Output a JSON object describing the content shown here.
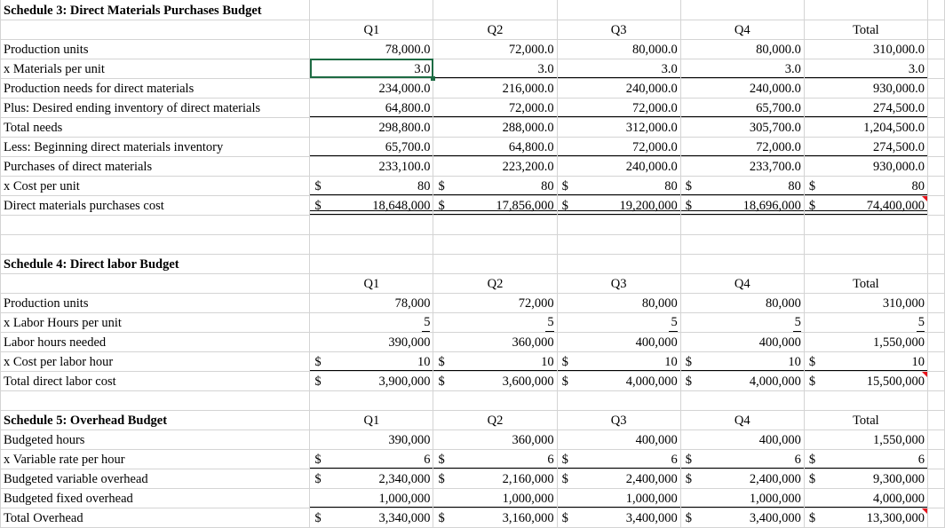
{
  "sheet": {
    "columns": [
      "",
      "Q1",
      "Q2",
      "Q3",
      "Q4",
      "Total"
    ],
    "selected_cell_value": "3.0",
    "selection_color": "#1d6b43",
    "comment_flag_color": "#e8121a",
    "gridline_color": "#d4d4d4"
  },
  "schedule3": {
    "title": "Schedule 3:  Direct Materials Purchases Budget",
    "headers": {
      "q1": "Q1",
      "q2": "Q2",
      "q3": "Q3",
      "q4": "Q4",
      "total": "Total"
    },
    "rows": [
      {
        "label": "Production units",
        "q1": "78,000.0",
        "q2": "72,000.0",
        "q3": "80,000.0",
        "q4": "80,000.0",
        "total": "310,000.0"
      },
      {
        "label": "x Materials per unit",
        "q1": "3.0",
        "q2": "3.0",
        "q3": "3.0",
        "q4": "3.0",
        "total": "3.0"
      },
      {
        "label": "Production needs for direct materials",
        "q1": "234,000.0",
        "q2": "216,000.0",
        "q3": "240,000.0",
        "q4": "240,000.0",
        "total": "930,000.0"
      },
      {
        "label": "Plus:  Desired ending inventory of direct materials",
        "q1": "64,800.0",
        "q2": "72,000.0",
        "q3": "72,000.0",
        "q4": "65,700.0",
        "total": "274,500.0"
      },
      {
        "label": "Total needs",
        "q1": "298,800.0",
        "q2": "288,000.0",
        "q3": "312,000.0",
        "q4": "305,700.0",
        "total": "1,204,500.0"
      },
      {
        "label": "Less:  Beginning direct materials inventory",
        "q1": "65,700.0",
        "q2": "64,800.0",
        "q3": "72,000.0",
        "q4": "72,000.0",
        "total": "274,500.0"
      },
      {
        "label": "Purchases of direct materials",
        "q1": "233,100.0",
        "q2": "223,200.0",
        "q3": "240,000.0",
        "q4": "233,700.0",
        "total": "930,000.0"
      },
      {
        "label": "x Cost per unit",
        "currency": "$",
        "q1": "80",
        "q2": "80",
        "q3": "80",
        "q4": "80",
        "total": "80"
      },
      {
        "label": "Direct materials purchases cost",
        "currency": "$",
        "q1": "18,648,000",
        "q2": "17,856,000",
        "q3": "19,200,000",
        "q4": "18,696,000",
        "total": "74,400,000"
      }
    ]
  },
  "schedule4": {
    "title": "Schedule 4:  Direct labor Budget",
    "headers": {
      "q1": "Q1",
      "q2": "Q2",
      "q3": "Q3",
      "q4": "Q4",
      "total": "Total"
    },
    "rows": [
      {
        "label": "Production units",
        "q1": "78,000",
        "q2": "72,000",
        "q3": "80,000",
        "q4": "80,000",
        "total": "310,000"
      },
      {
        "label": "x Labor Hours per unit",
        "q1": "5",
        "q2": "5",
        "q3": "5",
        "q4": "5",
        "total": "5"
      },
      {
        "label": "Labor hours needed",
        "q1": "390,000",
        "q2": "360,000",
        "q3": "400,000",
        "q4": "400,000",
        "total": "1,550,000"
      },
      {
        "label": "x Cost per labor hour",
        "currency": "$",
        "q1": "10",
        "q2": "10",
        "q3": "10",
        "q4": "10",
        "total": "10"
      },
      {
        "label": "Total direct labor cost",
        "currency": "$",
        "q1": "3,900,000",
        "q2": "3,600,000",
        "q3": "4,000,000",
        "q4": "4,000,000",
        "total": "15,500,000"
      }
    ]
  },
  "schedule5": {
    "title": "Schedule 5:  Overhead Budget",
    "headers": {
      "q1": "Q1",
      "q2": "Q2",
      "q3": "Q3",
      "q4": "Q4",
      "total": "Total"
    },
    "rows": [
      {
        "label": "Budgeted hours",
        "q1": "390,000",
        "q2": "360,000",
        "q3": "400,000",
        "q4": "400,000",
        "total": "1,550,000"
      },
      {
        "label": "x Variable rate per hour",
        "currency": "$",
        "q1": "6",
        "q2": "6",
        "q3": "6",
        "q4": "6",
        "total": "6"
      },
      {
        "label": "Budgeted variable overhead",
        "currency": "$",
        "q1": "2,340,000",
        "q2": "2,160,000",
        "q3": "2,400,000",
        "q4": "2,400,000",
        "total": "9,300,000"
      },
      {
        "label": "Budgeted fixed overhead",
        "q1": "1,000,000",
        "q2": "1,000,000",
        "q3": "1,000,000",
        "q4": "1,000,000",
        "total": "4,000,000"
      },
      {
        "label": "Total Overhead",
        "currency": "$",
        "q1": "3,340,000",
        "q2": "3,160,000",
        "q3": "3,400,000",
        "q4": "3,400,000",
        "total": "13,300,000"
      }
    ]
  }
}
